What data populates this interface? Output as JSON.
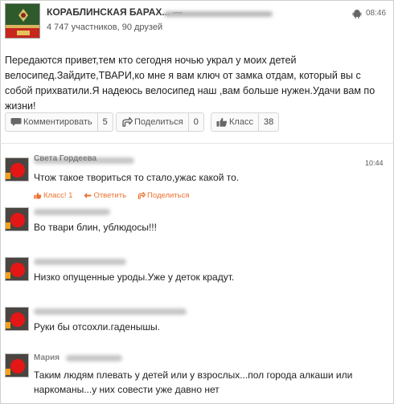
{
  "group": {
    "title": "КОРАБЛИНСКАЯ БАРАХ... —",
    "members": "4 747 участников,",
    "friends": "90 друзей",
    "time": "08:46"
  },
  "post": {
    "text": "Передаются привет,тем кто сегодня ночью украл у моих детей велосипед.Зайдите,ТВАРИ,ко мне я вам ключ от замка отдам, который вы с собой прихватили.Я надеюсь велосипед наш ,вам больше нужен.Удачи вам по жизни!"
  },
  "actions": {
    "comment_label": "Комментировать",
    "comment_count": "5",
    "share_label": "Поделиться",
    "share_count": "0",
    "like_label": "Класс",
    "like_count": "38"
  },
  "comments": [
    {
      "name": "Света Гордеева",
      "text": "Чтож такое твориться то стало,ужас какой то.",
      "time": "10:44",
      "like_label": "Класс! 1",
      "reply_label": "Ответить",
      "share_label": "Поделиться"
    },
    {
      "name": "",
      "text": "Во твари блин, ублюдосы!!!"
    },
    {
      "name": "",
      "text": "Низко опущенные уроды.Уже у деток крадут."
    },
    {
      "name": "",
      "text": "Руки бы отсохли.гаденышы."
    },
    {
      "name": "Мария",
      "text": "Таким людям плевать у детей или у взрослых...пол города алкаши или наркоманы...у них совести уже давно нет"
    }
  ],
  "icons": {
    "android": "android-icon",
    "comment": "comment-bubble-icon",
    "share": "share-arrow-icon",
    "like": "thumbs-up-icon",
    "reply": "reply-arrow-icon"
  },
  "colors": {
    "accent": "#eb722e",
    "avatar_dot": "#e51616"
  }
}
